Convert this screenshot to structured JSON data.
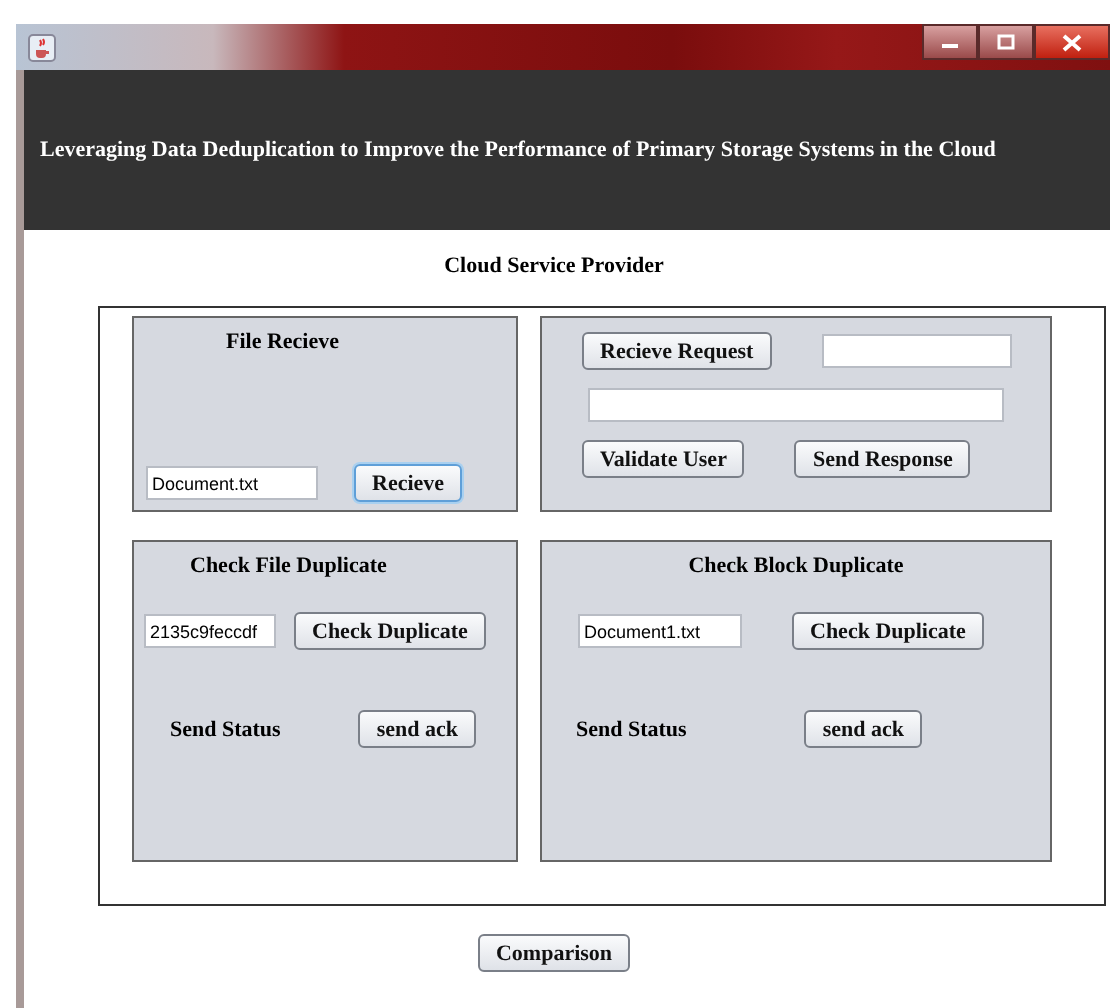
{
  "header": {
    "title": "Leveraging Data Deduplication to Improve the Performance of Primary Storage Systems in the Cloud"
  },
  "section_title": "Cloud Service Provider",
  "panels": [
    {
      "kind": "receive",
      "title": "File Recieve",
      "field": "Document.txt",
      "button": {
        "label": "Recieve",
        "focused": true
      }
    },
    {
      "kind": "request",
      "buttons": [
        {
          "label": "Recieve Request",
          "focused": false
        },
        {
          "label": "Validate User",
          "focused": false
        },
        {
          "label": "Send Response",
          "focused": false
        }
      ]
    },
    {
      "kind": "check",
      "title": "Check File Duplicate",
      "field": "2135c9feccdf",
      "button": {
        "label": "Check Duplicate",
        "focused": false
      },
      "status_label": "Send Status",
      "ack_button": {
        "label": "send ack",
        "focused": false
      }
    },
    {
      "kind": "check",
      "title": "Check Block Duplicate",
      "field": "Document1.txt",
      "button": {
        "label": "Check Duplicate",
        "focused": false
      },
      "status_label": "Send Status",
      "ack_button": {
        "label": "send ack",
        "focused": false
      }
    }
  ],
  "footer_button": {
    "label": "Comparison",
    "focused": false
  }
}
